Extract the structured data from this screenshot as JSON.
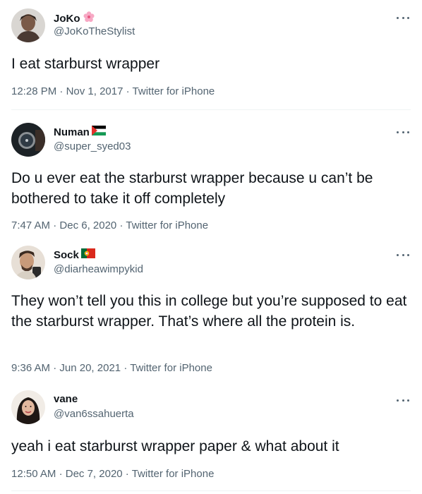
{
  "tweets": [
    {
      "name": "JoKo",
      "name_emoji": "cherry-blossom-icon",
      "handle": "@JoKoTheStylist",
      "text": "I eat starburst wrapper",
      "time": "12:28 PM",
      "date": "Nov 1, 2017",
      "source": "Twitter for iPhone"
    },
    {
      "name": "Numan",
      "name_emoji": "palestine-flag-icon",
      "handle": "@super_syed03",
      "text": "Do u ever eat the starburst wrapper because u can’t be bothered to take it off completely",
      "time": "7:47 AM",
      "date": "Dec 6, 2020",
      "source": "Twitter for iPhone"
    },
    {
      "name": "Sock",
      "name_emoji": "portugal-flag-icon",
      "handle": "@diarheawimpykid",
      "text": "They won’t tell you this in college but you’re supposed to eat the starburst wrapper. That’s where all the protein is.",
      "time": "9:36 AM",
      "date": "Jun 20, 2021",
      "source": "Twitter for iPhone"
    },
    {
      "name": "vane",
      "name_emoji": "",
      "handle": "@van6ssahuerta",
      "text": "yeah i eat starburst wrapper paper & what about it",
      "time": "12:50 AM",
      "date": "Dec 7, 2020",
      "source": "Twitter for iPhone"
    }
  ],
  "separator": "·",
  "colors": {
    "text": "#0f1419",
    "secondary": "#536471",
    "divider": "#eff3f4"
  }
}
